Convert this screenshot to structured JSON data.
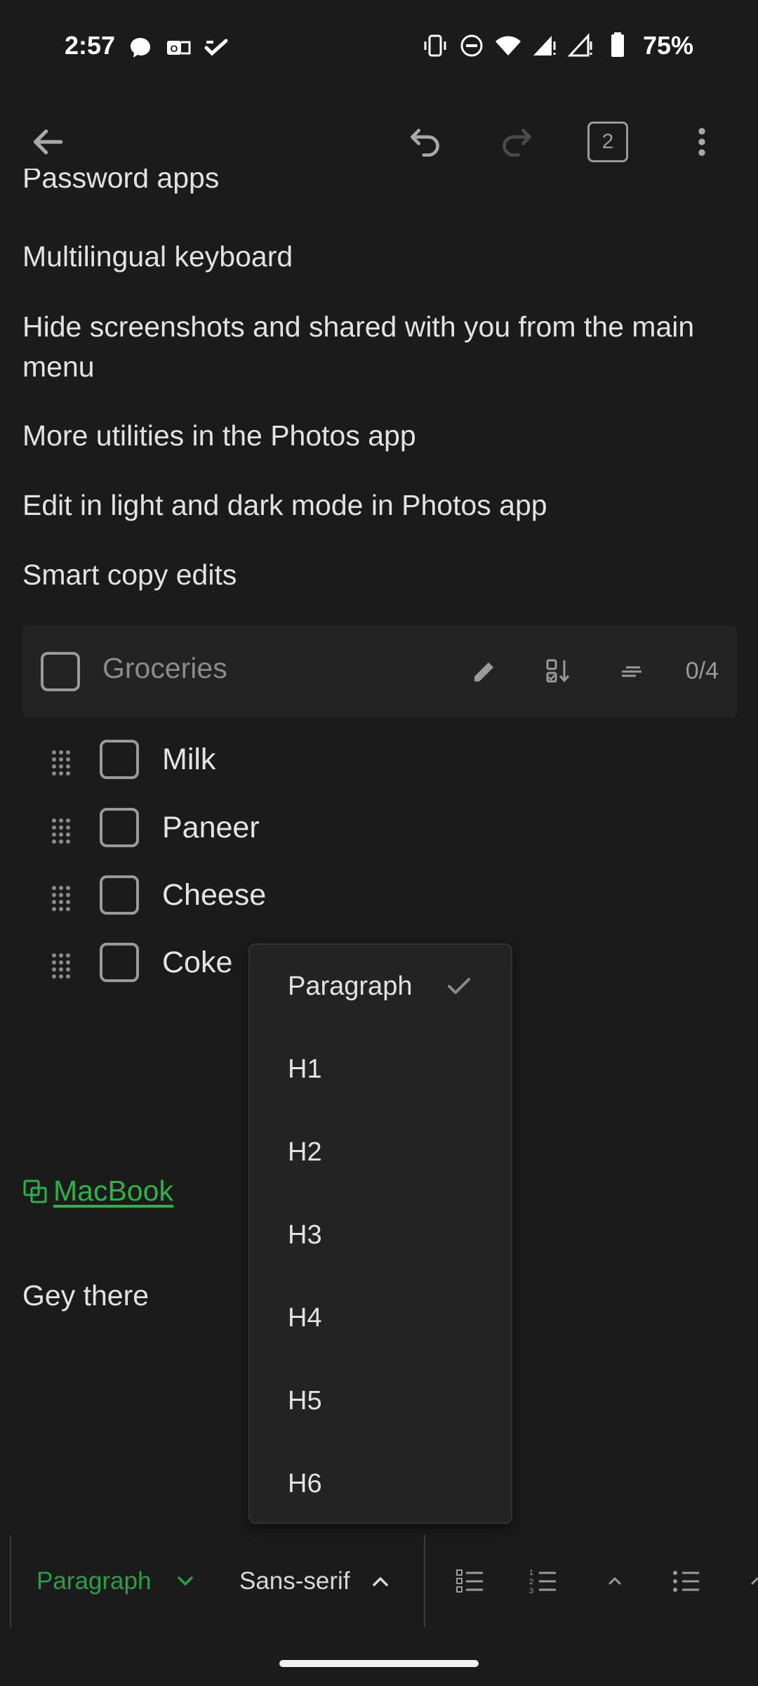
{
  "status_bar": {
    "time": "2:57",
    "battery": "75%"
  },
  "app_bar": {
    "page_count": "2"
  },
  "note": {
    "paragraphs": [
      "Password apps",
      "Multilingual keyboard",
      "Hide screenshots and shared with you from the main menu",
      "More utilities in the Photos app",
      "Edit in light and dark mode in Photos app",
      "Smart copy edits"
    ],
    "checklist": {
      "title_placeholder": "Groceries",
      "count": "0/4",
      "items": [
        "Milk",
        "Paneer",
        "Cheese",
        "Coke"
      ]
    },
    "after_text": "Gey there",
    "link_text": "MacBook"
  },
  "dropdown": {
    "options": [
      "Paragraph",
      "H1",
      "H2",
      "H3",
      "H4",
      "H5",
      "H6"
    ],
    "selected": "Paragraph"
  },
  "toolbar": {
    "paragraph_label": "Paragraph",
    "font_label": "Sans-serif"
  },
  "colors": {
    "background": "#1b1b1b",
    "accent_green": "#2bb24c",
    "surface": "#232323"
  }
}
